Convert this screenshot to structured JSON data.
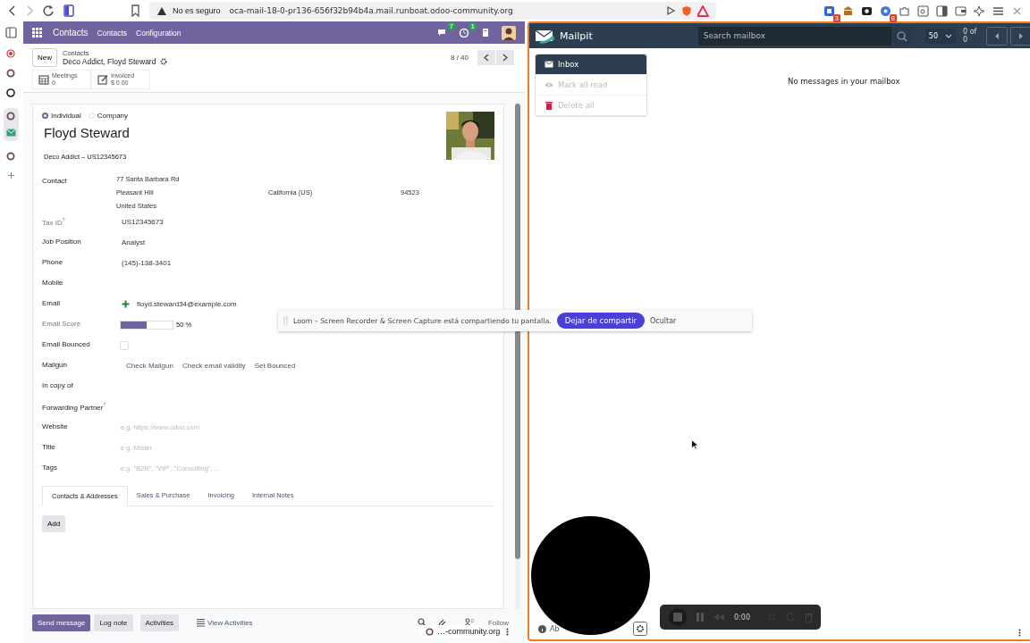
{
  "browser": {
    "security": "No es seguro",
    "url": "oca-mail-18-0-pr136-656f32b94b4a.mail.runboat.odoo-community.org",
    "extension_badges": [
      "3",
      "8"
    ]
  },
  "odoo": {
    "navbar": {
      "app": "Contacts",
      "menus": [
        "Contacts",
        "Configuration"
      ],
      "message_count": "7",
      "activity_count": "1"
    },
    "control_panel": {
      "new_button": "New",
      "parent": "Contacts",
      "current": "Deco Addict, Floyd Steward",
      "pager": "8 / 40"
    },
    "smart_buttons": [
      {
        "kind": "calendar",
        "label": "Meetings",
        "value": "0"
      },
      {
        "kind": "invoice",
        "label": "Invoiced",
        "value": "$ 0.00"
      }
    ],
    "form": {
      "types": [
        {
          "label": "Individual",
          "selected": true
        },
        {
          "label": "Company",
          "selected": false
        }
      ],
      "name": "Floyd Steward",
      "company_line": "Deco Addict – US12345673",
      "fields": [
        {
          "label": "Contact",
          "kind": "address",
          "lines": [
            [
              "77 Santa Barbara Rd"
            ],
            [
              "Pleasant Hill",
              "California (US)",
              "94523"
            ],
            [
              "United States"
            ]
          ]
        },
        {
          "label": "Tax ID$^{?}$",
          "kind": "text",
          "readonly": true,
          "value": "US12345673"
        },
        {
          "label": "Job Position",
          "kind": "text",
          "value": "Analyst"
        },
        {
          "label": "Phone",
          "kind": "text",
          "value": "(145)-138-3401"
        },
        {
          "label": "Mobile",
          "kind": "text"
        },
        {
          "label": "Email",
          "kind": "email",
          "value": "floyd.steward34@example.com"
        },
        {
          "label": "Email Score",
          "kind": "score",
          "readonly": true,
          "level": 0.5,
          "reading": "50 %"
        },
        {
          "label": "Email Bounced",
          "kind": "checkbox",
          "checked": false
        },
        {
          "label": "Mailgun",
          "kind": "buttons",
          "buttons": [
            "Check Mailgun",
            "Check email validity",
            "Set Bounced"
          ]
        },
        {
          "label": "In copy of",
          "kind": "text"
        },
        {
          "label": "Forwarding Partner$^{?}$",
          "kind": "text"
        },
        {
          "label": "Website",
          "kind": "input",
          "placeholder": "e.g. https://www.odoo.com"
        },
        {
          "label": "Title",
          "kind": "input",
          "placeholder": "e.g. Mister"
        },
        {
          "label": "Tags",
          "kind": "input",
          "placeholder": "e.g. \"B2B\", \"VIP\", \"Consulting\", ..."
        }
      ],
      "tabs": [
        {
          "label": "Contacts & Addresses",
          "selected": true
        },
        {
          "label": "Sales & Purchase",
          "selected": false
        },
        {
          "label": "Invoicing",
          "selected": false
        },
        {
          "label": "Internal Notes",
          "selected": false
        }
      ],
      "add_button": "Add"
    },
    "chatter": {
      "buttons": [
        {
          "label": "Send message",
          "kind": "primary"
        },
        {
          "label": "Log note",
          "kind": "secondary"
        },
        {
          "label": "Activities",
          "kind": "secondary"
        }
      ],
      "view_activities": "View Activities",
      "follower_count": "0",
      "follow": "Follow"
    },
    "status_link": "…-community.org"
  },
  "mailpit": {
    "brand": "Mailpit",
    "search": {
      "placeholder": "Search mailbox"
    },
    "per_page": "50",
    "count": "0 of 0",
    "menu": [
      {
        "kind": "inbox",
        "label": "Inbox",
        "selected": true,
        "disabled": false
      },
      {
        "kind": "read",
        "label": "Mark all read",
        "selected": false,
        "disabled": true
      },
      {
        "kind": "delete",
        "label": "Delete all",
        "selected": false,
        "disabled": true
      }
    ],
    "empty_message": "No messages in your mailbox",
    "about": "Ab"
  },
  "loom": {
    "message": "Loom – Screen Recorder & Screen Capture está compartiendo tu pantalla.",
    "stop_button": "Dejar de compartir",
    "hide_button": "Ocultar"
  },
  "recorder": {
    "time": "0:00"
  }
}
